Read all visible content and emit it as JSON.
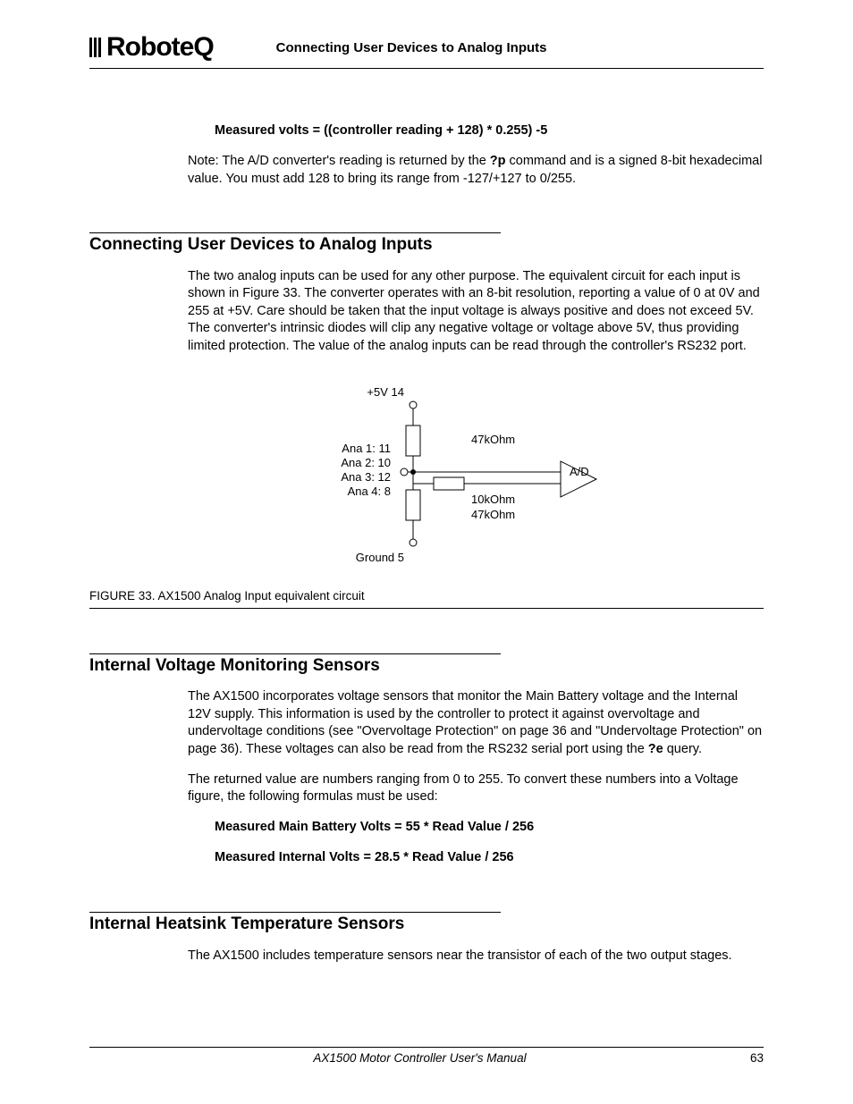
{
  "header": {
    "brand": "RoboteQ",
    "running_title": "Connecting User Devices to Analog Inputs"
  },
  "intro": {
    "formula": "Measured volts = ((controller reading + 128) * 0.255) -5",
    "note_pre": "Note: The A/D converter's reading is returned by the ",
    "note_cmd": "?p",
    "note_post": " command and is a signed 8-bit hexadecimal value. You must add 128 to bring its range from -127/+127 to 0/255."
  },
  "section1": {
    "title": "Connecting User Devices to Analog Inputs",
    "para": "The two analog inputs can be used for any other purpose. The equivalent circuit for each input is shown in Figure 33. The converter operates with an 8-bit resolution, reporting a value of 0 at 0V and 255 at +5V. Care should be taken that the input voltage is always positive and does not exceed 5V. The converter's intrinsic diodes will clip any negative voltage or voltage above 5V, thus providing limited protection. The value of the analog inputs can be read through the controller's RS232 port."
  },
  "figure": {
    "top_label": "+5V  14",
    "ana1": "Ana 1:  11",
    "ana2": "Ana 2:  10",
    "ana3": "Ana 3:  12",
    "ana4": "Ana 4:    8",
    "r_top": "47kOhm",
    "r_mid": "10kOhm",
    "r_bot": "47kOhm",
    "ad": "A/D",
    "ground": "Ground  5",
    "caption": "FIGURE 33.  AX1500 Analog Input equivalent circuit"
  },
  "section2": {
    "title": "Internal Voltage Monitoring Sensors",
    "para1_pre": "The AX1500 incorporates voltage sensors that monitor the Main Battery voltage and the Internal 12V supply. This information is used by the controller to protect it against overvoltage and undervoltage conditions (see \"Overvoltage Protection\" on page 36 and \"Undervoltage Protection\" on page 36). These voltages can also be read from the RS232 serial port using the ",
    "para1_cmd": "?e",
    "para1_post": " query.",
    "para2": "The returned value are numbers ranging from 0 to 255. To convert these numbers into a Voltage figure, the following formulas must be used:",
    "formula1": "Measured Main Battery Volts = 55 * Read Value / 256",
    "formula2": "Measured Internal Volts = 28.5 * Read Value / 256"
  },
  "section3": {
    "title": "Internal Heatsink Temperature Sensors",
    "para": "The AX1500 includes temperature sensors near the transistor of each of the two output stages."
  },
  "footer": {
    "doc": "AX1500 Motor Controller User's Manual",
    "page": "63"
  }
}
